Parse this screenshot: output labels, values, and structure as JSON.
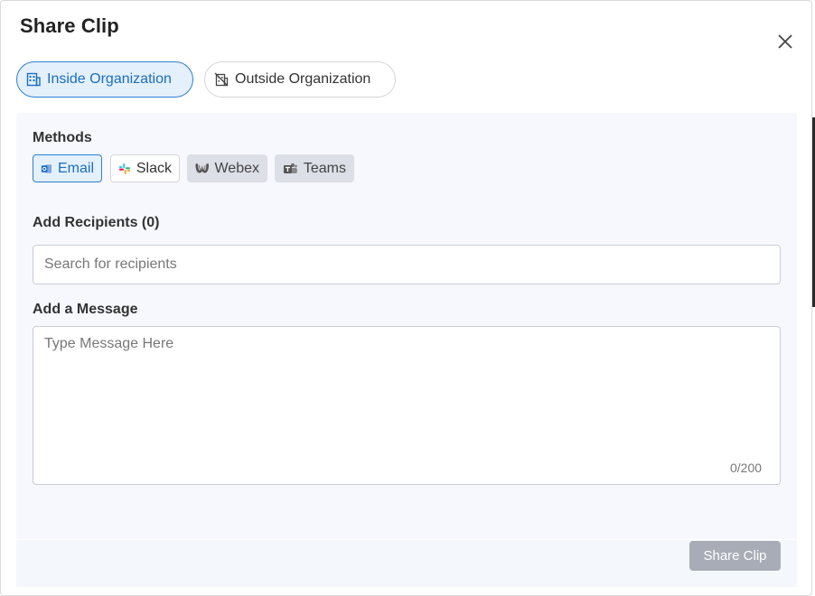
{
  "modal": {
    "title": "Share Clip"
  },
  "tabs": [
    {
      "label": "Inside Organization",
      "icon": "building-icon",
      "active": true
    },
    {
      "label": "Outside Organization",
      "icon": "building-off-icon",
      "active": false
    }
  ],
  "methods": {
    "label": "Methods",
    "items": [
      {
        "label": "Email",
        "icon": "outlook-icon",
        "selected": true
      },
      {
        "label": "Slack",
        "icon": "slack-icon",
        "selected": false
      },
      {
        "label": "Webex",
        "icon": "webex-icon",
        "disabled": true
      },
      {
        "label": "Teams",
        "icon": "teams-icon",
        "disabled": true
      }
    ]
  },
  "recipients": {
    "label": "Add Recipients (0)",
    "placeholder": "Search for recipients",
    "value": ""
  },
  "message": {
    "label": "Add a Message",
    "placeholder": "Type Message Here",
    "value": "",
    "counter": "0/200"
  },
  "footer": {
    "share_label": "Share Clip"
  },
  "colors": {
    "accent": "#1a6ec0",
    "accent_bg": "#e4f0fc",
    "panel_bg": "#f6f8fd",
    "disabled_button": "#a8acb6"
  }
}
